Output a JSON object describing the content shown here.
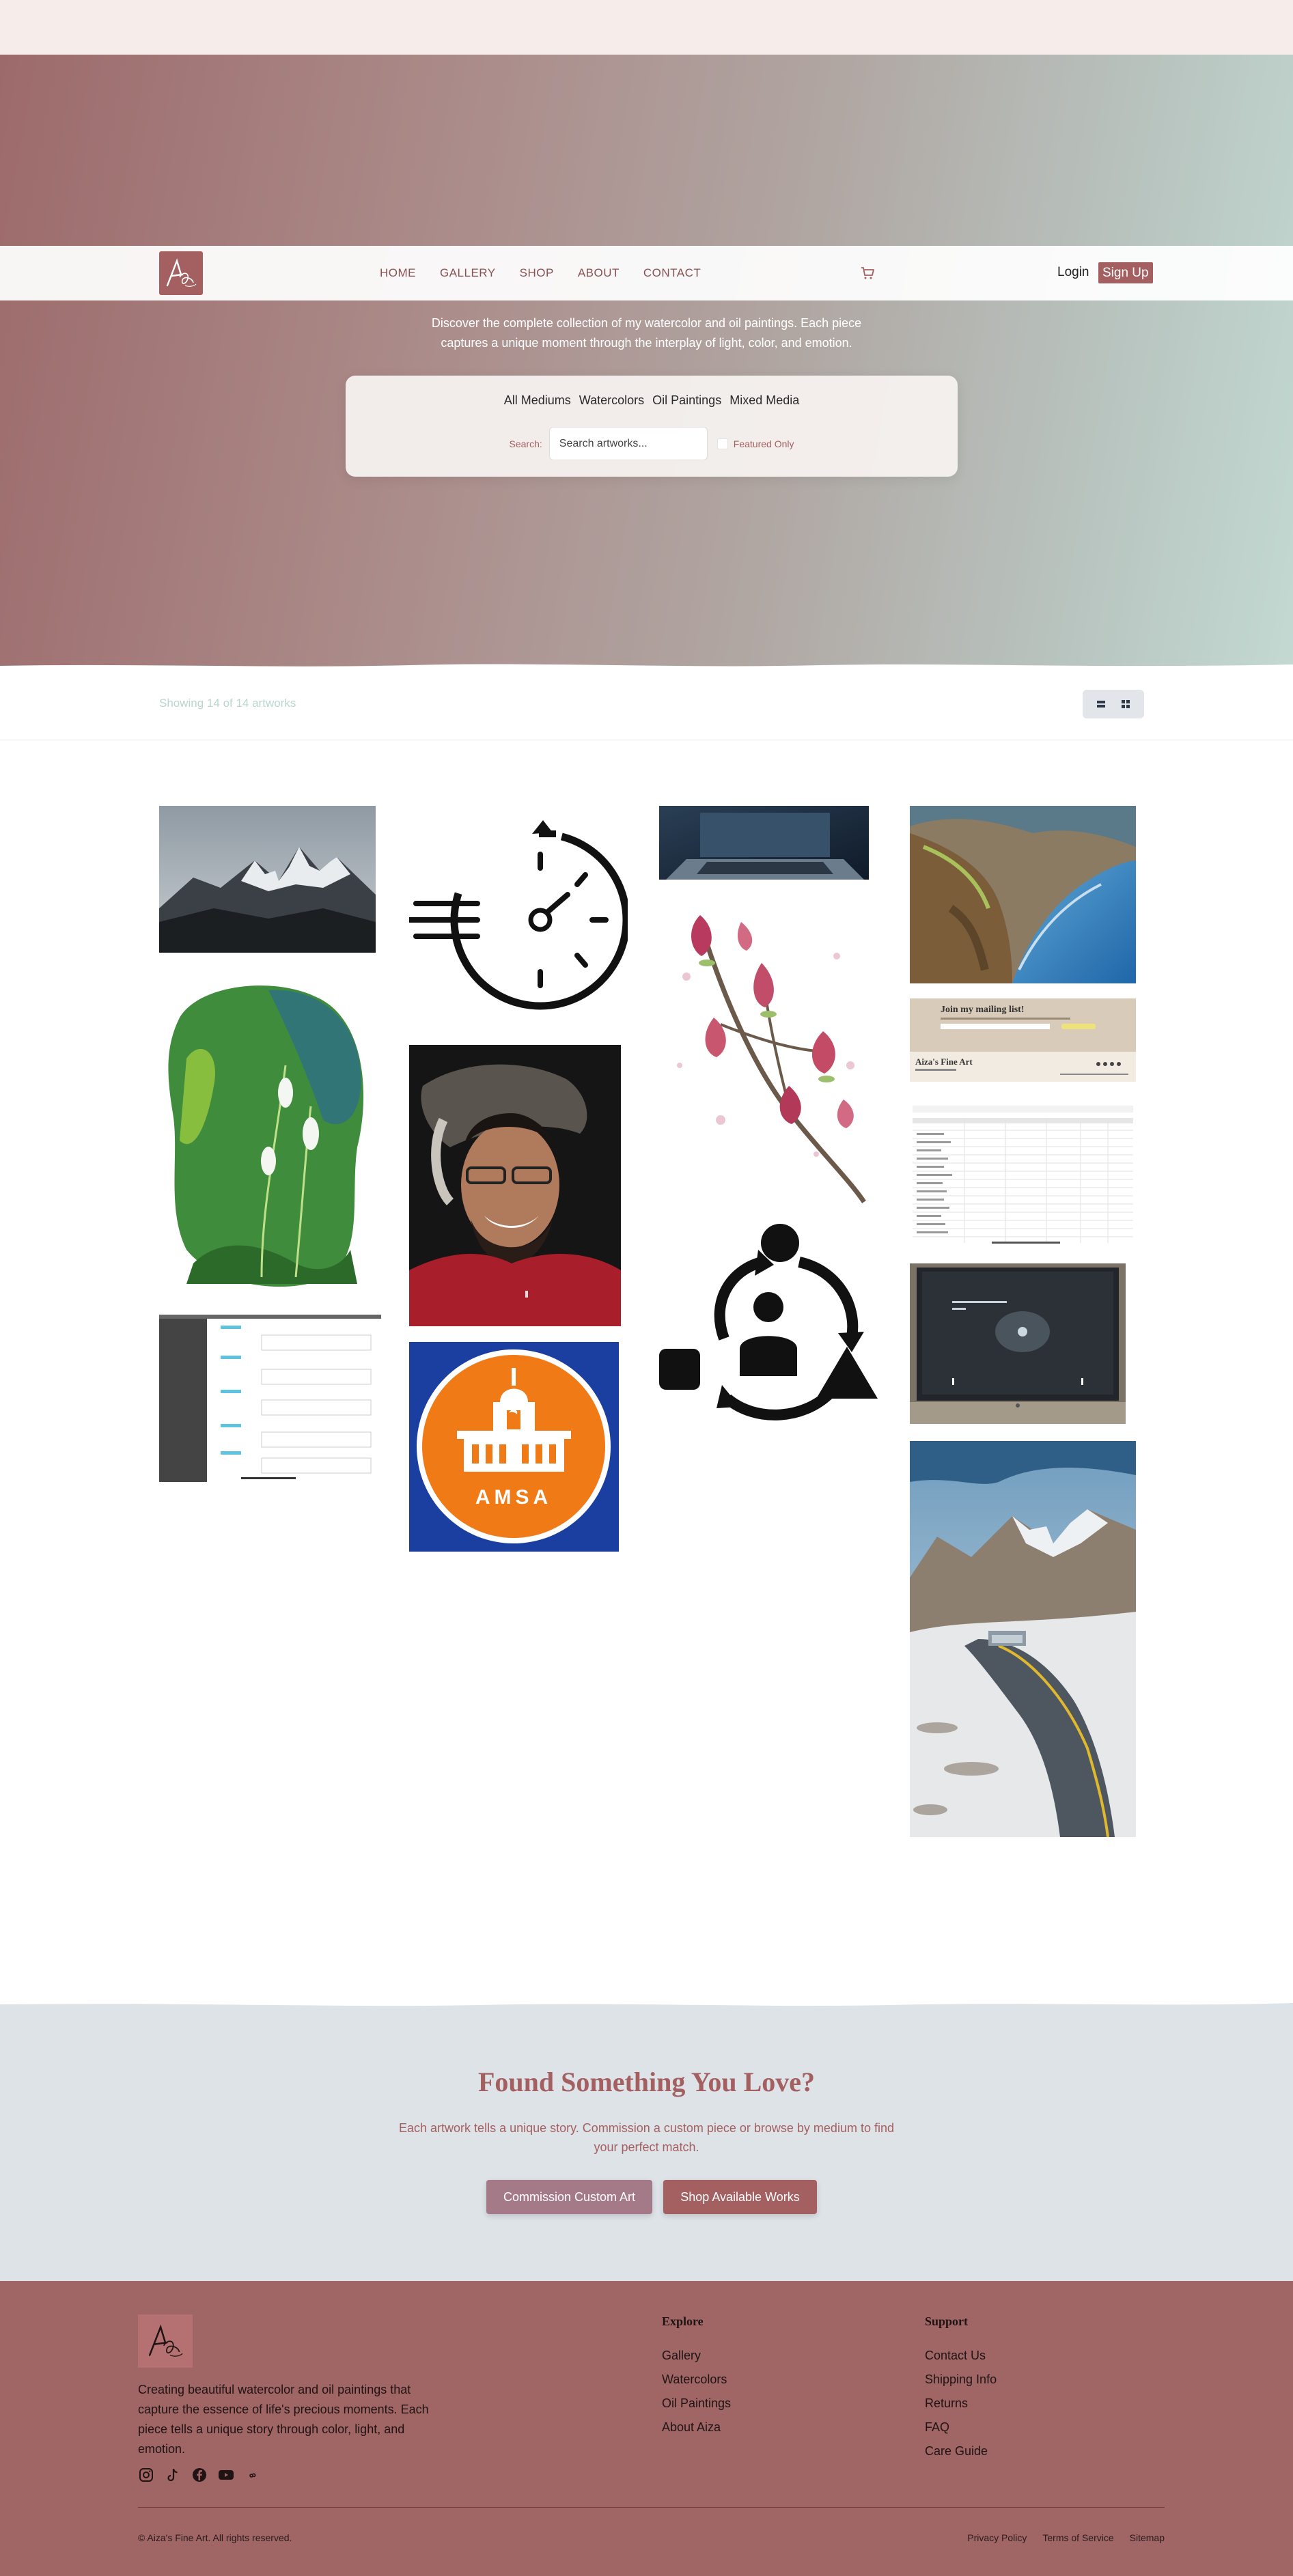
{
  "nav": {
    "links": [
      "HOME",
      "GALLERY",
      "SHOP",
      "ABOUT",
      "CONTACT"
    ],
    "login": "Login",
    "signup": "Sign Up"
  },
  "hero": {
    "description_line1": "Discover the complete collection of my watercolor and oil paintings. Each piece",
    "description_line2": "captures a unique moment through the interplay of light, color, and emotion."
  },
  "filters": {
    "tabs": [
      "All Mediums",
      "Watercolors",
      "Oil Paintings",
      "Mixed Media"
    ],
    "search_label": "Search:",
    "search_placeholder": "Search artworks...",
    "featured_label": "Featured Only"
  },
  "results": {
    "count_text": "Showing 14 of 14 artworks"
  },
  "gallery": {
    "amsa_text": "AMSA",
    "mailing_title": "Join my mailing list!",
    "mailing_brand": "Aiza's Fine Art"
  },
  "cta": {
    "title": "Found Something You Love?",
    "desc_line1": "Each artwork tells a unique story. Commission a custom piece or browse by medium to find",
    "desc_line2": "your perfect match.",
    "btn_commission": "Commission Custom Art",
    "btn_shop": "Shop Available Works"
  },
  "footer": {
    "description": "Creating beautiful watercolor and oil paintings that capture the essence of life's precious moments. Each piece tells a unique story through color, light, and emotion.",
    "explore_title": "Explore",
    "explore_links": [
      "Gallery",
      "Watercolors",
      "Oil Paintings",
      "About Aiza"
    ],
    "support_title": "Support",
    "support_links": [
      "Contact Us",
      "Shipping Info",
      "Returns",
      "FAQ",
      "Care Guide"
    ],
    "copyright": "© Aiza's Fine Art. All rights reserved.",
    "legal_links": [
      "Privacy Policy",
      "Terms of Service",
      "Sitemap"
    ]
  },
  "colors": {
    "brand": "#a45f60",
    "accent_mauve": "#a47988",
    "cta_bg": "#dee3e8",
    "footer_bg": "#a06666"
  },
  "icons": [
    "cart-icon",
    "list-view-icon",
    "grid-view-icon",
    "instagram-icon",
    "tiktok-icon",
    "facebook-icon",
    "youtube-icon",
    "threads-icon"
  ]
}
